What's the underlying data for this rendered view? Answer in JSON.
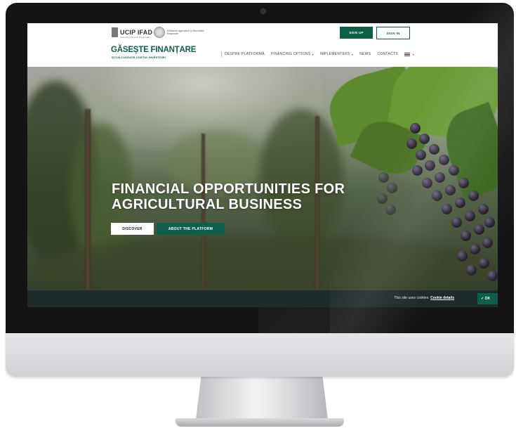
{
  "topbar": {
    "ucip_label": "UCIP IFAD",
    "ucip_sub": "UNITATEA DE CONSOLIDARE",
    "ministry_label": "Ministerul Agriculturii și Dezvoltării Regionale",
    "signup_label": "SIGN UP",
    "signin_label": "SIGN IN"
  },
  "brand": {
    "title": "GĂSEȘTE FINANȚARE",
    "subtitle": "ȘI CALCULEAZĂ COSTUL INVESTIȚIEI"
  },
  "nav": {
    "items": [
      {
        "label": "DESPRE PLATFORMĂ",
        "has_dropdown": false
      },
      {
        "label": "FINANCING OPTIONS",
        "has_dropdown": true
      },
      {
        "label": "IMPLEMENTERS",
        "has_dropdown": true
      },
      {
        "label": "NEWS",
        "has_dropdown": false
      },
      {
        "label": "CONTACTS",
        "has_dropdown": false
      }
    ],
    "language_icon": "uk-flag-icon"
  },
  "hero": {
    "title_line1": "FINANCIAL OPPORTUNITIES FOR",
    "title_line2": "AGRICULTURAL BUSINESS",
    "discover_label": "DISCOVER",
    "about_label": "ABOUT THE PLATFORM"
  },
  "cookie": {
    "text": "This site uses cookies.",
    "link": "Cookie details",
    "ok_label": "✓ OK"
  },
  "colors": {
    "brand_green": "#0d5f49",
    "cookie_bg": "#1f2a2c"
  }
}
